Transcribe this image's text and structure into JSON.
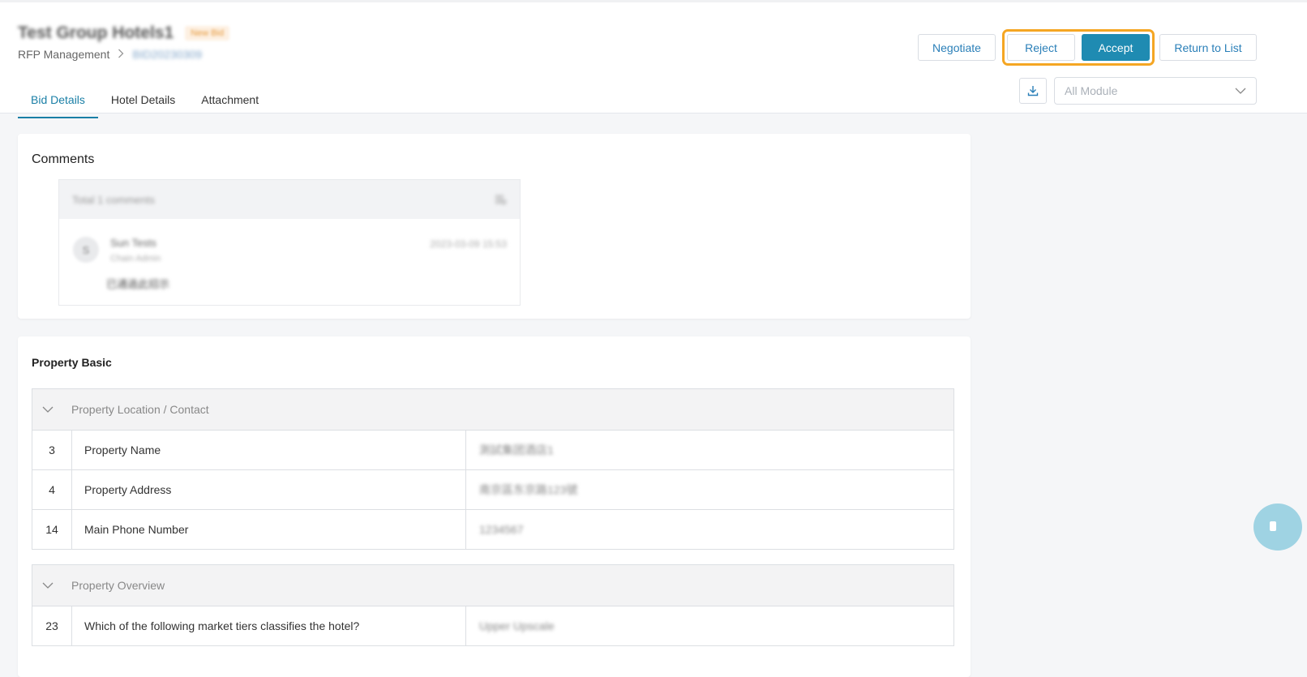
{
  "header": {
    "title": "Test Group Hotels1",
    "status_tag": "New Bid",
    "breadcrumb": [
      "RFP Management",
      "BID20230309"
    ],
    "actions": {
      "negotiate": "Negotiate",
      "reject": "Reject",
      "accept": "Accept",
      "return_to_list": "Return to List"
    },
    "module_select": {
      "value": "All Module"
    }
  },
  "tabs": [
    {
      "label": "Bid Details",
      "active": true
    },
    {
      "label": "Hotel Details",
      "active": false
    },
    {
      "label": "Attachment",
      "active": false
    }
  ],
  "comments": {
    "title": "Comments",
    "total_label": "Total 1 comments",
    "items": [
      {
        "avatar": "S",
        "author": "Sun Tests",
        "role": "Chain Admin",
        "time": "2023-03-09 15:53",
        "text": "已通過此招示"
      }
    ]
  },
  "property_basic": {
    "title": "Property Basic",
    "sections": [
      {
        "name": "Property Location / Contact",
        "rows": [
          {
            "num": "3",
            "label": "Property Name",
            "value": "測試集团酒店1"
          },
          {
            "num": "4",
            "label": "Property Address",
            "value": "南京區东京路123號"
          },
          {
            "num": "14",
            "label": "Main Phone Number",
            "value": "1234567"
          }
        ]
      },
      {
        "name": "Property Overview",
        "rows": [
          {
            "num": "23",
            "label": "Which of the following market tiers classifies the hotel?",
            "value": "Upper Upscale"
          }
        ]
      }
    ]
  },
  "colors": {
    "primary": "#1f8bb2",
    "link": "#2a7fb8",
    "highlight": "#f5a623",
    "tab_active": "#1a7fa6"
  },
  "icons": [
    "chevron-right-icon",
    "download-icon",
    "chevron-down-icon",
    "filter-list-icon",
    "chat-float-icon"
  ]
}
